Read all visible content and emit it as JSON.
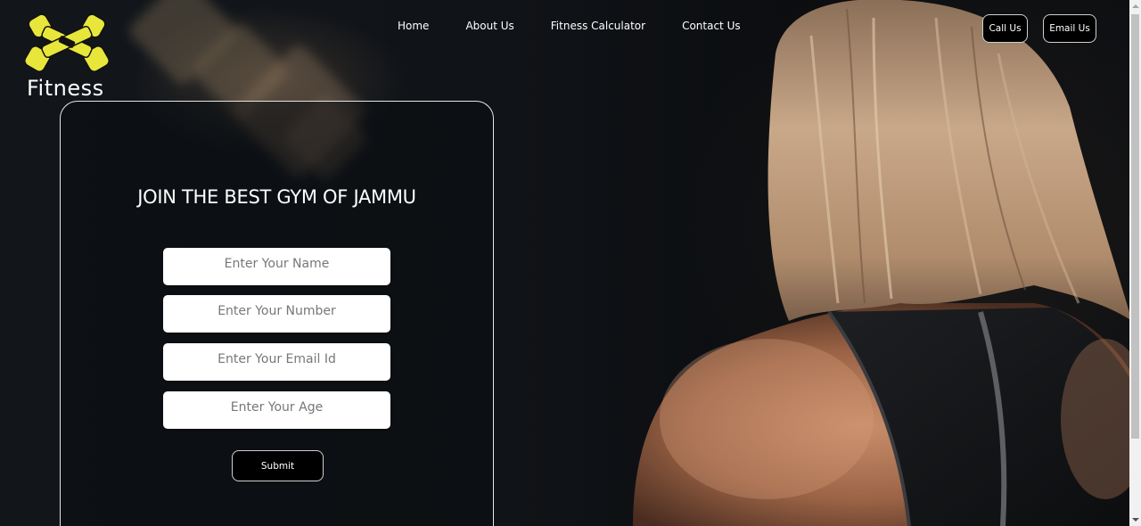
{
  "brand": {
    "name": "Fitness",
    "logo_icon": "dumbbell-logo-icon",
    "logo_color": "#e8e63a"
  },
  "nav": {
    "items": [
      {
        "label": "Home"
      },
      {
        "label": "About Us"
      },
      {
        "label": "Fitness Calculator"
      },
      {
        "label": "Contact Us"
      }
    ]
  },
  "header_buttons": {
    "call_label": "Call Us",
    "email_label": "Email Us"
  },
  "form": {
    "title": "JOIN THE BEST GYM OF JAMMU",
    "name_placeholder": "Enter Your Name",
    "number_placeholder": "Enter Your Number",
    "email_placeholder": "Enter Your Email Id",
    "age_placeholder": "Enter Your Age",
    "submit_label": "Submit"
  },
  "colors": {
    "background": "#0f1216",
    "accent": "#e8e63a",
    "button_bg": "#000000",
    "text": "#ffffff"
  }
}
